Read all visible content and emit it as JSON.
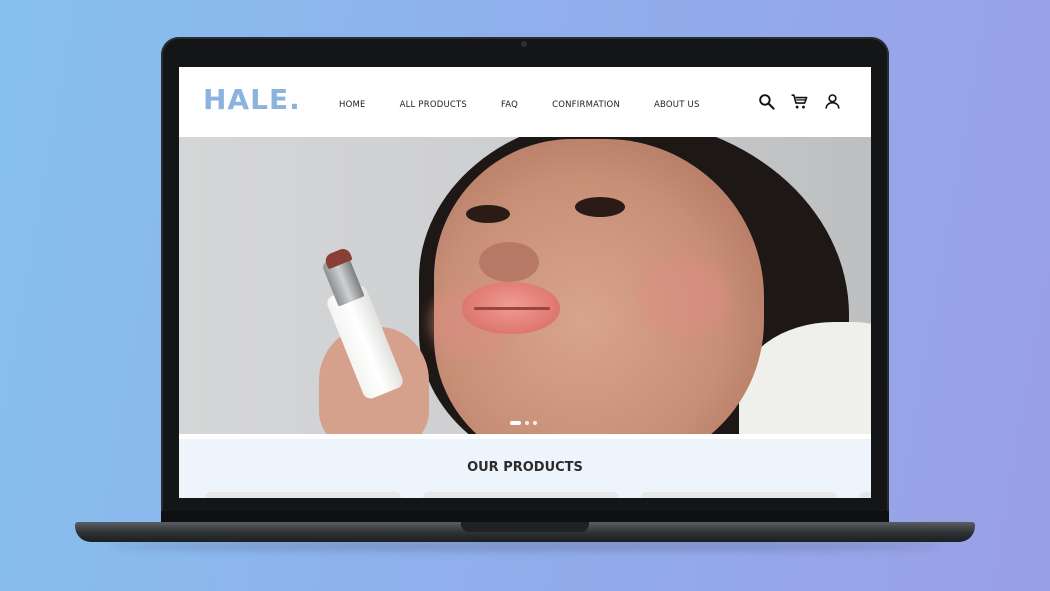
{
  "brand": {
    "logo": "HALE.",
    "logo_color": "#8cb3dd"
  },
  "nav": {
    "items": [
      "HOME",
      "ALL PRODUCTS",
      "FAQ",
      "CONFIRMATION",
      "ABOUT US"
    ]
  },
  "header_icons": [
    "search-icon",
    "cart-icon",
    "account-icon"
  ],
  "hero": {
    "image": "model holding lipstick",
    "carousel": {
      "slides": 3,
      "active_index": 0
    }
  },
  "products": {
    "title": "OUR PRODUCTS"
  },
  "colors": {
    "background_gradient_start": "#86c1ee",
    "background_gradient_end": "#9a9fe6",
    "products_band": "#eef4fb"
  }
}
